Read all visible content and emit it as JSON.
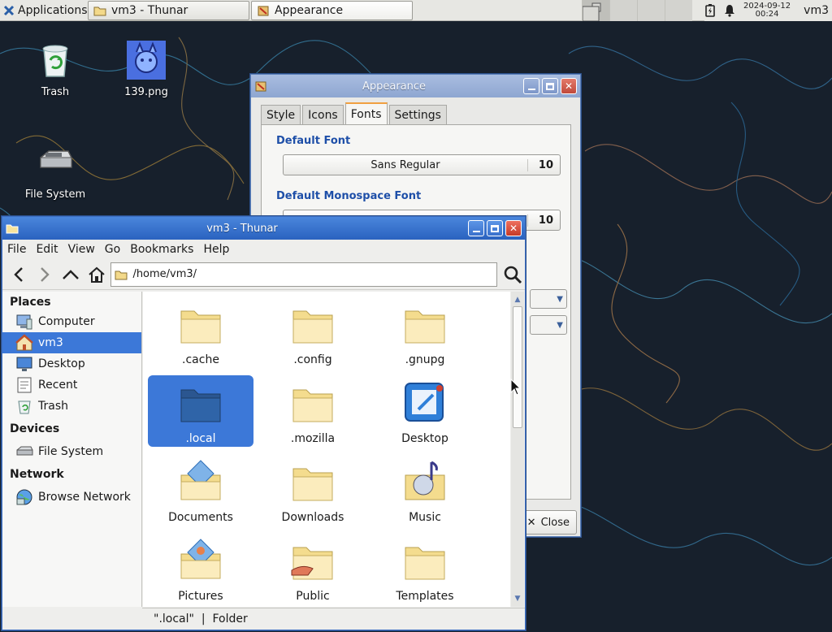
{
  "taskbar": {
    "apps_label": "Applications",
    "tasks": [
      {
        "label": "vm3 - Thunar",
        "icon": "folder-icon"
      },
      {
        "label": "Appearance",
        "icon": "appearance-icon"
      }
    ],
    "clock_date": "2024-09-12",
    "clock_time": "00:24",
    "user": "vm3"
  },
  "desktop": {
    "icons": [
      {
        "label": "Trash",
        "icon": "trash-icon"
      },
      {
        "label": "139.png",
        "icon": "image-icon"
      },
      {
        "label": "File System",
        "icon": "drive-icon"
      }
    ]
  },
  "appearance": {
    "title": "Appearance",
    "tabs": [
      "Style",
      "Icons",
      "Fonts",
      "Settings"
    ],
    "selected_tab": "Fonts",
    "default_font_heading": "Default Font",
    "default_font_name": "Sans Regular",
    "default_font_size": "10",
    "mono_font_heading": "Default Monospace Font",
    "mono_font_size": "10",
    "close_label": "Close"
  },
  "thunar": {
    "title": "vm3 - Thunar",
    "menu": [
      "File",
      "Edit",
      "View",
      "Go",
      "Bookmarks",
      "Help"
    ],
    "path": "/home/vm3/",
    "sidebar": {
      "places_heading": "Places",
      "places": [
        {
          "label": "Computer",
          "icon": "computer-icon"
        },
        {
          "label": "vm3",
          "icon": "home-icon"
        },
        {
          "label": "Desktop",
          "icon": "desktop-icon"
        },
        {
          "label": "Recent",
          "icon": "recent-icon"
        },
        {
          "label": "Trash",
          "icon": "trash-icon"
        }
      ],
      "devices_heading": "Devices",
      "devices": [
        {
          "label": "File System",
          "icon": "drive-icon"
        }
      ],
      "network_heading": "Network",
      "network": [
        {
          "label": "Browse Network",
          "icon": "network-icon"
        }
      ]
    },
    "files": [
      {
        "label": ".cache",
        "icon": "folder-icon"
      },
      {
        "label": ".config",
        "icon": "folder-icon"
      },
      {
        "label": ".gnupg",
        "icon": "folder-icon"
      },
      {
        "label": ".local",
        "icon": "folder-icon"
      },
      {
        "label": ".mozilla",
        "icon": "folder-icon"
      },
      {
        "label": "Desktop",
        "icon": "desktop-folder-icon"
      },
      {
        "label": "Documents",
        "icon": "documents-folder-icon"
      },
      {
        "label": "Downloads",
        "icon": "folder-icon"
      },
      {
        "label": "Music",
        "icon": "music-folder-icon"
      },
      {
        "label": "Pictures",
        "icon": "pictures-folder-icon"
      },
      {
        "label": "Public",
        "icon": "public-folder-icon"
      },
      {
        "label": "Templates",
        "icon": "folder-icon"
      }
    ],
    "selected_file": ".local",
    "status": "\".local\"  |  Folder"
  },
  "colors": {
    "selection": "#3c78d8",
    "heading_blue": "#1e4fa8",
    "active_title": "#2a62bf",
    "inactive_title": "#8ea6d1",
    "folder": "#f7e29a"
  }
}
